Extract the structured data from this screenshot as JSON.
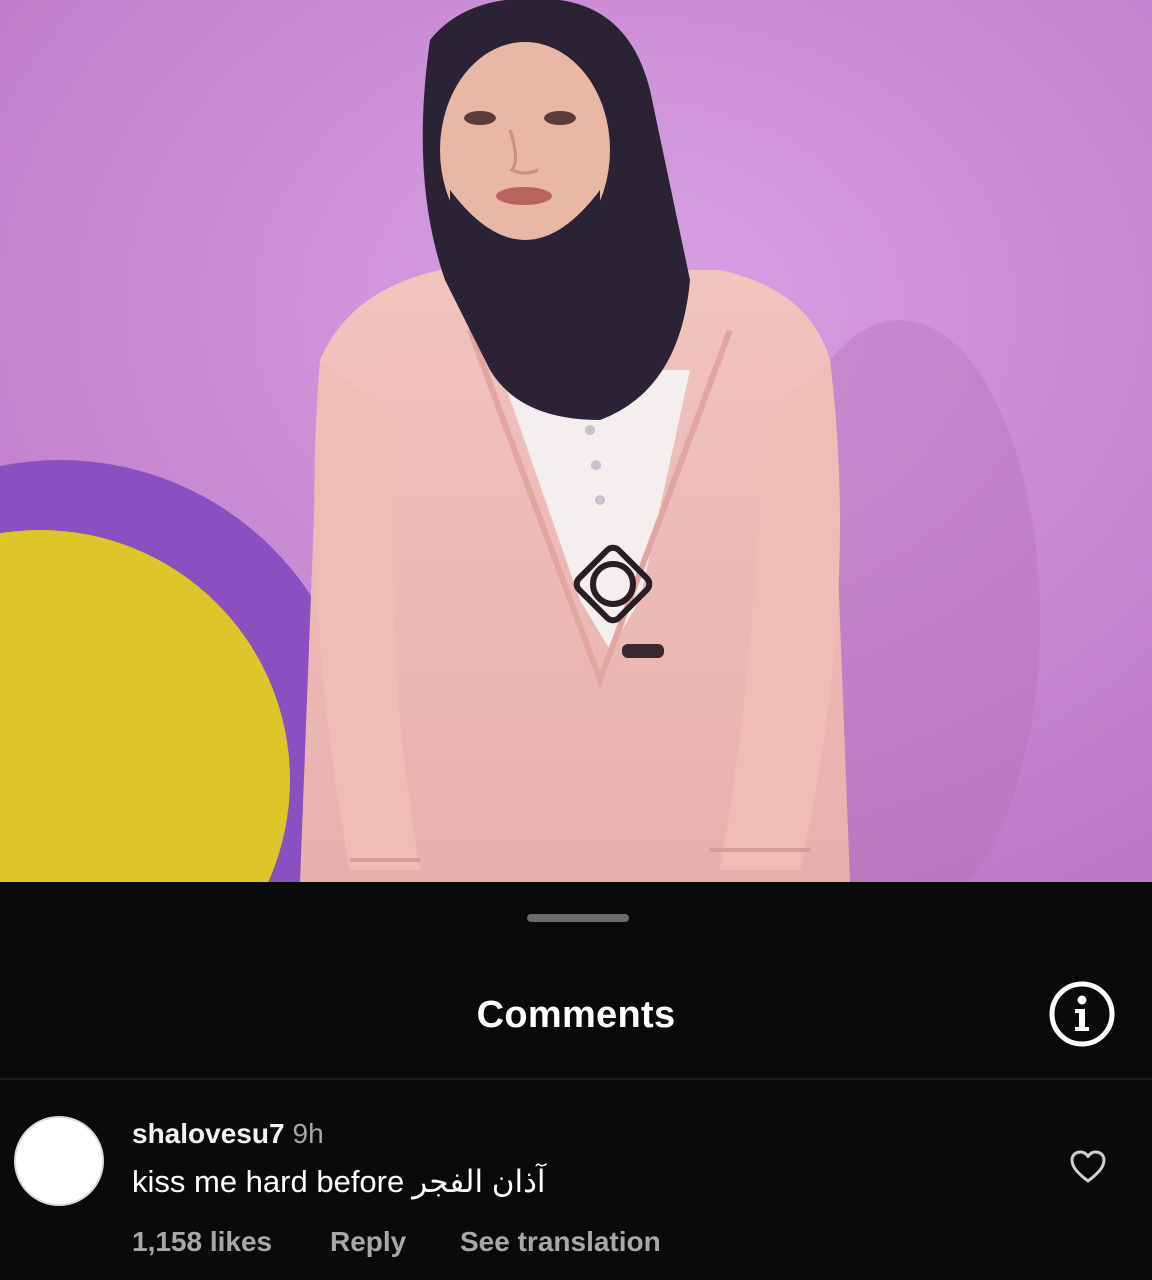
{
  "sheet": {
    "title": "Comments",
    "info_icon": "info-circle-icon"
  },
  "comment": {
    "username": "shalovesu7",
    "time": "9h",
    "text_en": "kiss me hard before",
    "text_ar": "آذان الفجر",
    "likes": "1,158 likes",
    "reply_label": "Reply",
    "translate_label": "See translation",
    "like_icon": "heart-outline-icon"
  },
  "colors": {
    "sheet_bg": "#0a0a0a",
    "text_primary": "#ffffff",
    "text_secondary": "#a8a8a8",
    "wall": "#c98ad6"
  }
}
